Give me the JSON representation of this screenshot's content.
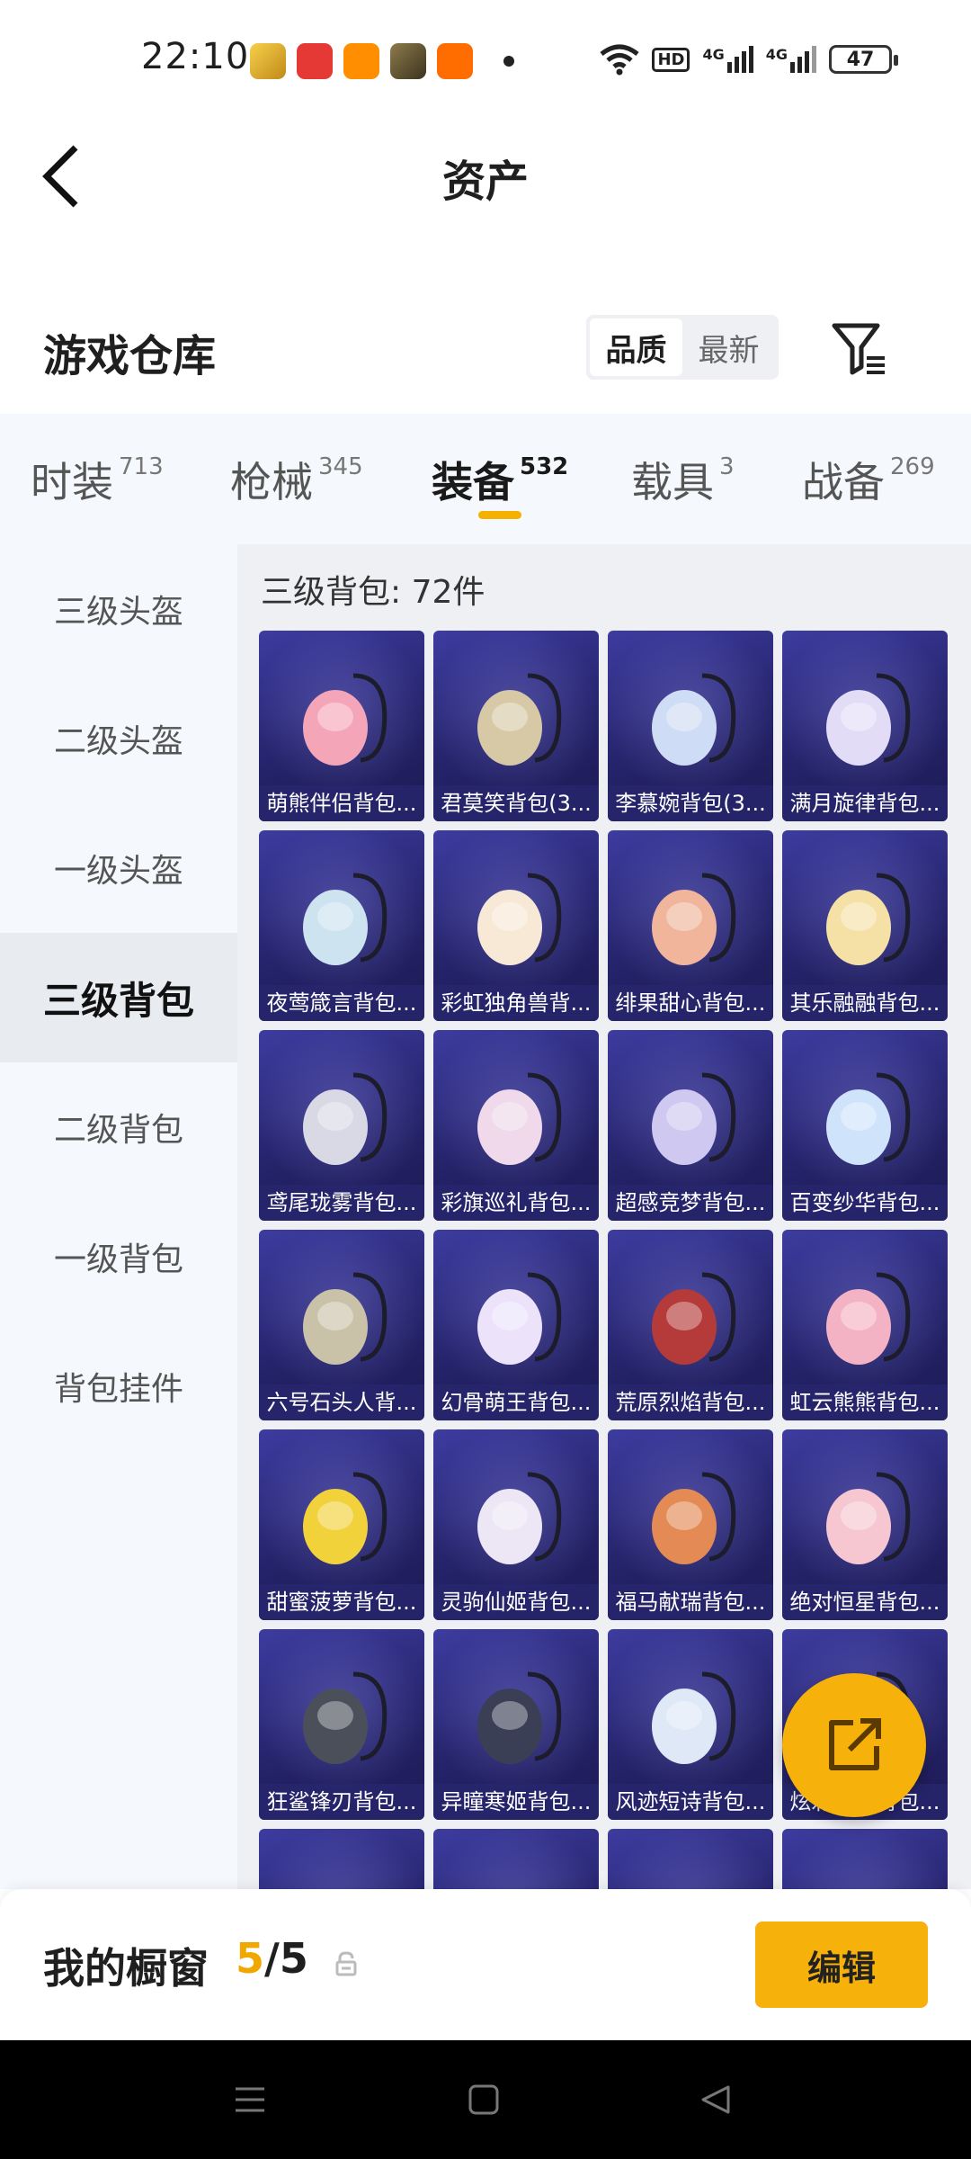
{
  "status_bar": {
    "time": "22:10",
    "battery": "47",
    "hd_label": "HD",
    "net1": "4G",
    "net2": "4G"
  },
  "nav": {
    "title": "资产"
  },
  "warehouse": {
    "title": "游戏仓库",
    "sort_options": [
      "品质",
      "最新"
    ],
    "sort_selected": "品质"
  },
  "tabs": [
    {
      "label": "时装",
      "count": "713"
    },
    {
      "label": "枪械",
      "count": "345"
    },
    {
      "label": "装备",
      "count": "532"
    },
    {
      "label": "载具",
      "count": "3"
    },
    {
      "label": "战备",
      "count": "269"
    }
  ],
  "active_tab": "装备",
  "sidebar": {
    "items": [
      "三级头盔",
      "二级头盔",
      "一级头盔",
      "三级背包",
      "二级背包",
      "一级背包",
      "背包挂件"
    ],
    "active": "三级背包"
  },
  "section_title": "三级背包: 72件",
  "items": [
    "萌熊伴侣背包...",
    "君莫笑背包(3...",
    "李慕婉背包(3...",
    "满月旋律背包...",
    "夜莺箴言背包...",
    "彩虹独角兽背...",
    "绯果甜心背包...",
    "其乐融融背包...",
    "鸢尾珑雾背包...",
    "彩旗巡礼背包...",
    "超感竞梦背包...",
    "百变纱华背包...",
    "六号石头人背...",
    "幻骨萌王背包...",
    "荒原烈焰背包...",
    "虹云熊熊背包...",
    "甜蜜菠萝背包...",
    "灵驹仙姬背包...",
    "福马献瑞背包...",
    "绝对恒星背包...",
    "狂鲨锋刃背包...",
    "异瞳寒姬背包...",
    "风迹短诗背包...",
    "炫彩星辰背包..."
  ],
  "showcase": {
    "title": "我的橱窗",
    "count_current": "5",
    "count_sep": "/",
    "count_total": "5",
    "edit_label": "编辑"
  },
  "colors": {
    "accent": "#f6b10a",
    "card_bg": "#2b2978"
  }
}
